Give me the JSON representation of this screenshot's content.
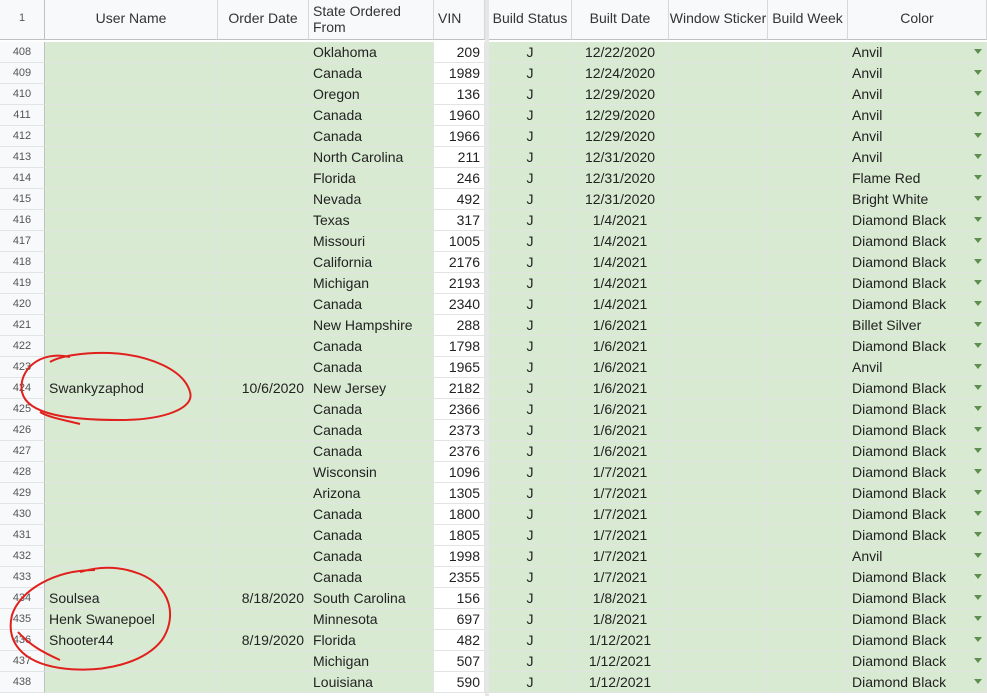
{
  "headers": {
    "corner": "1",
    "user_name": "User Name",
    "order_date": "Order Date",
    "state": "State Ordered From",
    "vin": "VIN",
    "build_status": "Build Status",
    "built_date": "Built Date",
    "window_sticker": "Window Sticker",
    "build_week": "Build Week",
    "color": "Color"
  },
  "rows": [
    {
      "n": "408",
      "user": "",
      "date": "",
      "state": "Oklahoma",
      "vin": "209",
      "status": "J",
      "built": "12/22/2020",
      "color": "Anvil"
    },
    {
      "n": "409",
      "user": "",
      "date": "",
      "state": "Canada",
      "vin": "1989",
      "status": "J",
      "built": "12/24/2020",
      "color": "Anvil"
    },
    {
      "n": "410",
      "user": "",
      "date": "",
      "state": "Oregon",
      "vin": "136",
      "status": "J",
      "built": "12/29/2020",
      "color": "Anvil"
    },
    {
      "n": "411",
      "user": "",
      "date": "",
      "state": "Canada",
      "vin": "1960",
      "status": "J",
      "built": "12/29/2020",
      "color": "Anvil"
    },
    {
      "n": "412",
      "user": "",
      "date": "",
      "state": "Canada",
      "vin": "1966",
      "status": "J",
      "built": "12/29/2020",
      "color": "Anvil"
    },
    {
      "n": "413",
      "user": "",
      "date": "",
      "state": "North Carolina",
      "vin": "211",
      "status": "J",
      "built": "12/31/2020",
      "color": "Anvil"
    },
    {
      "n": "414",
      "user": "",
      "date": "",
      "state": "Florida",
      "vin": "246",
      "status": "J",
      "built": "12/31/2020",
      "color": "Flame Red"
    },
    {
      "n": "415",
      "user": "",
      "date": "",
      "state": "Nevada",
      "vin": "492",
      "status": "J",
      "built": "12/31/2020",
      "color": "Bright White"
    },
    {
      "n": "416",
      "user": "",
      "date": "",
      "state": "Texas",
      "vin": "317",
      "status": "J",
      "built": "1/4/2021",
      "color": "Diamond Black"
    },
    {
      "n": "417",
      "user": "",
      "date": "",
      "state": "Missouri",
      "vin": "1005",
      "status": "J",
      "built": "1/4/2021",
      "color": "Diamond Black"
    },
    {
      "n": "418",
      "user": "",
      "date": "",
      "state": "California",
      "vin": "2176",
      "status": "J",
      "built": "1/4/2021",
      "color": "Diamond Black"
    },
    {
      "n": "419",
      "user": "",
      "date": "",
      "state": "Michigan",
      "vin": "2193",
      "status": "J",
      "built": "1/4/2021",
      "color": "Diamond Black"
    },
    {
      "n": "420",
      "user": "",
      "date": "",
      "state": "Canada",
      "vin": "2340",
      "status": "J",
      "built": "1/4/2021",
      "color": "Diamond Black"
    },
    {
      "n": "421",
      "user": "",
      "date": "",
      "state": "New Hampshire",
      "vin": "288",
      "status": "J",
      "built": "1/6/2021",
      "color": "Billet Silver"
    },
    {
      "n": "422",
      "user": "",
      "date": "",
      "state": "Canada",
      "vin": "1798",
      "status": "J",
      "built": "1/6/2021",
      "color": "Diamond Black"
    },
    {
      "n": "423",
      "user": "",
      "date": "",
      "state": "Canada",
      "vin": "1965",
      "status": "J",
      "built": "1/6/2021",
      "color": "Anvil"
    },
    {
      "n": "424",
      "user": "Swankyzaphod",
      "date": "10/6/2020",
      "state": "New Jersey",
      "vin": "2182",
      "status": "J",
      "built": "1/6/2021",
      "color": "Diamond Black"
    },
    {
      "n": "425",
      "user": "",
      "date": "",
      "state": "Canada",
      "vin": "2366",
      "status": "J",
      "built": "1/6/2021",
      "color": "Diamond Black"
    },
    {
      "n": "426",
      "user": "",
      "date": "",
      "state": "Canada",
      "vin": "2373",
      "status": "J",
      "built": "1/6/2021",
      "color": "Diamond Black"
    },
    {
      "n": "427",
      "user": "",
      "date": "",
      "state": "Canada",
      "vin": "2376",
      "status": "J",
      "built": "1/6/2021",
      "color": "Diamond Black"
    },
    {
      "n": "428",
      "user": "",
      "date": "",
      "state": "Wisconsin",
      "vin": "1096",
      "status": "J",
      "built": "1/7/2021",
      "color": "Diamond Black"
    },
    {
      "n": "429",
      "user": "",
      "date": "",
      "state": "Arizona",
      "vin": "1305",
      "status": "J",
      "built": "1/7/2021",
      "color": "Diamond Black"
    },
    {
      "n": "430",
      "user": "",
      "date": "",
      "state": "Canada",
      "vin": "1800",
      "status": "J",
      "built": "1/7/2021",
      "color": "Diamond Black"
    },
    {
      "n": "431",
      "user": "",
      "date": "",
      "state": "Canada",
      "vin": "1805",
      "status": "J",
      "built": "1/7/2021",
      "color": "Diamond Black"
    },
    {
      "n": "432",
      "user": "",
      "date": "",
      "state": "Canada",
      "vin": "1998",
      "status": "J",
      "built": "1/7/2021",
      "color": "Anvil"
    },
    {
      "n": "433",
      "user": "",
      "date": "",
      "state": "Canada",
      "vin": "2355",
      "status": "J",
      "built": "1/7/2021",
      "color": "Diamond Black"
    },
    {
      "n": "434",
      "user": "Soulsea",
      "date": "8/18/2020",
      "state": "South Carolina",
      "vin": "156",
      "status": "J",
      "built": "1/8/2021",
      "color": "Diamond Black"
    },
    {
      "n": "435",
      "user": "Henk Swanepoel",
      "date": "",
      "state": "Minnesota",
      "vin": "697",
      "status": "J",
      "built": "1/8/2021",
      "color": "Diamond Black"
    },
    {
      "n": "436",
      "user": "Shooter44",
      "date": "8/19/2020",
      "state": "Florida",
      "vin": "482",
      "status": "J",
      "built": "1/12/2021",
      "color": "Diamond Black"
    },
    {
      "n": "437",
      "user": "",
      "date": "",
      "state": "Michigan",
      "vin": "507",
      "status": "J",
      "built": "1/12/2021",
      "color": "Diamond Black"
    },
    {
      "n": "438",
      "user": "",
      "date": "",
      "state": "Louisiana",
      "vin": "590",
      "status": "J",
      "built": "1/12/2021",
      "color": "Diamond Black"
    }
  ],
  "colors": {
    "green_fill": "#d9ead3",
    "annotation": "#e0201c",
    "dropdown_arrow": "#5f8f4f"
  }
}
